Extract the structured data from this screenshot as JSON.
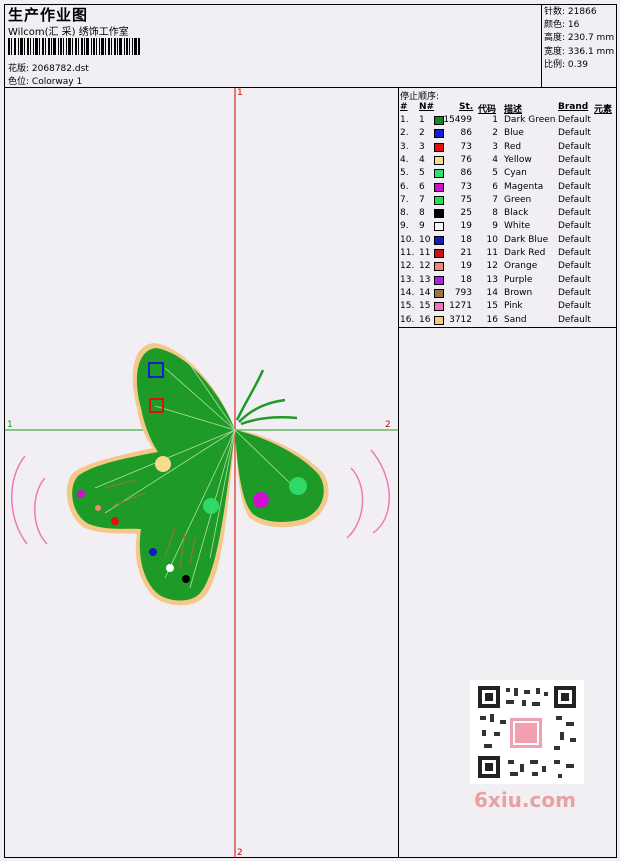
{
  "header": {
    "title": "生产作业图",
    "subtitle": "Wilcom(汇 采) 绣饰工作室",
    "pattern_label": "花版:",
    "pattern_value": "2068782.dst",
    "colorway_label": "色位:",
    "colorway_value": "Colorway 1"
  },
  "stats": {
    "stitches_label": "针数:",
    "stitches": "21866",
    "colors_label": "颜色:",
    "colors": "16",
    "height_label": "高度:",
    "height": "230.7 mm",
    "width_label": "宽度:",
    "width": "336.1 mm",
    "scale_label": "比例:",
    "scale": "0.39"
  },
  "stop_sequence": {
    "label": "停止顺序:",
    "columns": {
      "num": "#",
      "n": "N#",
      "st": "St.",
      "code": "代码",
      "desc": "描述",
      "brand": "Brand",
      "element": "元素"
    },
    "rows": [
      {
        "num": "1.",
        "n": "1",
        "color": "#0f8a1e",
        "st": "15499",
        "code": "1",
        "desc": "Dark Green",
        "brand": "Default"
      },
      {
        "num": "2.",
        "n": "2",
        "color": "#1020d0",
        "st": "86",
        "code": "2",
        "desc": "Blue",
        "brand": "Default"
      },
      {
        "num": "3.",
        "n": "3",
        "color": "#e01010",
        "st": "73",
        "code": "3",
        "desc": "Red",
        "brand": "Default"
      },
      {
        "num": "4.",
        "n": "4",
        "color": "#f7dc8c",
        "st": "76",
        "code": "4",
        "desc": "Yellow",
        "brand": "Default"
      },
      {
        "num": "5.",
        "n": "5",
        "color": "#30e070",
        "st": "86",
        "code": "5",
        "desc": "Cyan",
        "brand": "Default"
      },
      {
        "num": "6.",
        "n": "6",
        "color": "#d010d0",
        "st": "73",
        "code": "6",
        "desc": "Magenta",
        "brand": "Default"
      },
      {
        "num": "7.",
        "n": "7",
        "color": "#20e050",
        "st": "75",
        "code": "7",
        "desc": "Green",
        "brand": "Default"
      },
      {
        "num": "8.",
        "n": "8",
        "color": "#000000",
        "st": "25",
        "code": "8",
        "desc": "Black",
        "brand": "Default"
      },
      {
        "num": "9.",
        "n": "9",
        "color": "#f4f4f4",
        "st": "19",
        "code": "9",
        "desc": "White",
        "brand": "Default"
      },
      {
        "num": "10.",
        "n": "10",
        "color": "#1020c0",
        "st": "18",
        "code": "10",
        "desc": "Dark Blue",
        "brand": "Default"
      },
      {
        "num": "11.",
        "n": "11",
        "color": "#d01010",
        "st": "21",
        "code": "11",
        "desc": "Dark Red",
        "brand": "Default"
      },
      {
        "num": "12.",
        "n": "12",
        "color": "#f08878",
        "st": "19",
        "code": "12",
        "desc": "Orange",
        "brand": "Default"
      },
      {
        "num": "13.",
        "n": "13",
        "color": "#b020e0",
        "st": "18",
        "code": "13",
        "desc": "Purple",
        "brand": "Default"
      },
      {
        "num": "14.",
        "n": "14",
        "color": "#a0704a",
        "st": "793",
        "code": "14",
        "desc": "Brown",
        "brand": "Default"
      },
      {
        "num": "15.",
        "n": "15",
        "color": "#f078b8",
        "st": "1271",
        "code": "15",
        "desc": "Pink",
        "brand": "Default"
      },
      {
        "num": "16.",
        "n": "16",
        "color": "#f4c888",
        "st": "3712",
        "code": "16",
        "desc": "Sand",
        "brand": "Default"
      }
    ]
  },
  "axes": {
    "v_top": "1",
    "v_bottom": "2",
    "h_left": "1",
    "h_right": "2"
  },
  "watermark": "6xiu.com",
  "colors": {
    "axis_vertical": "#d00000",
    "axis_horizontal": "#1a9a1a",
    "fill": "#1e9a26",
    "outline": "#f4c888",
    "pink_arcs": "#f078b8"
  }
}
